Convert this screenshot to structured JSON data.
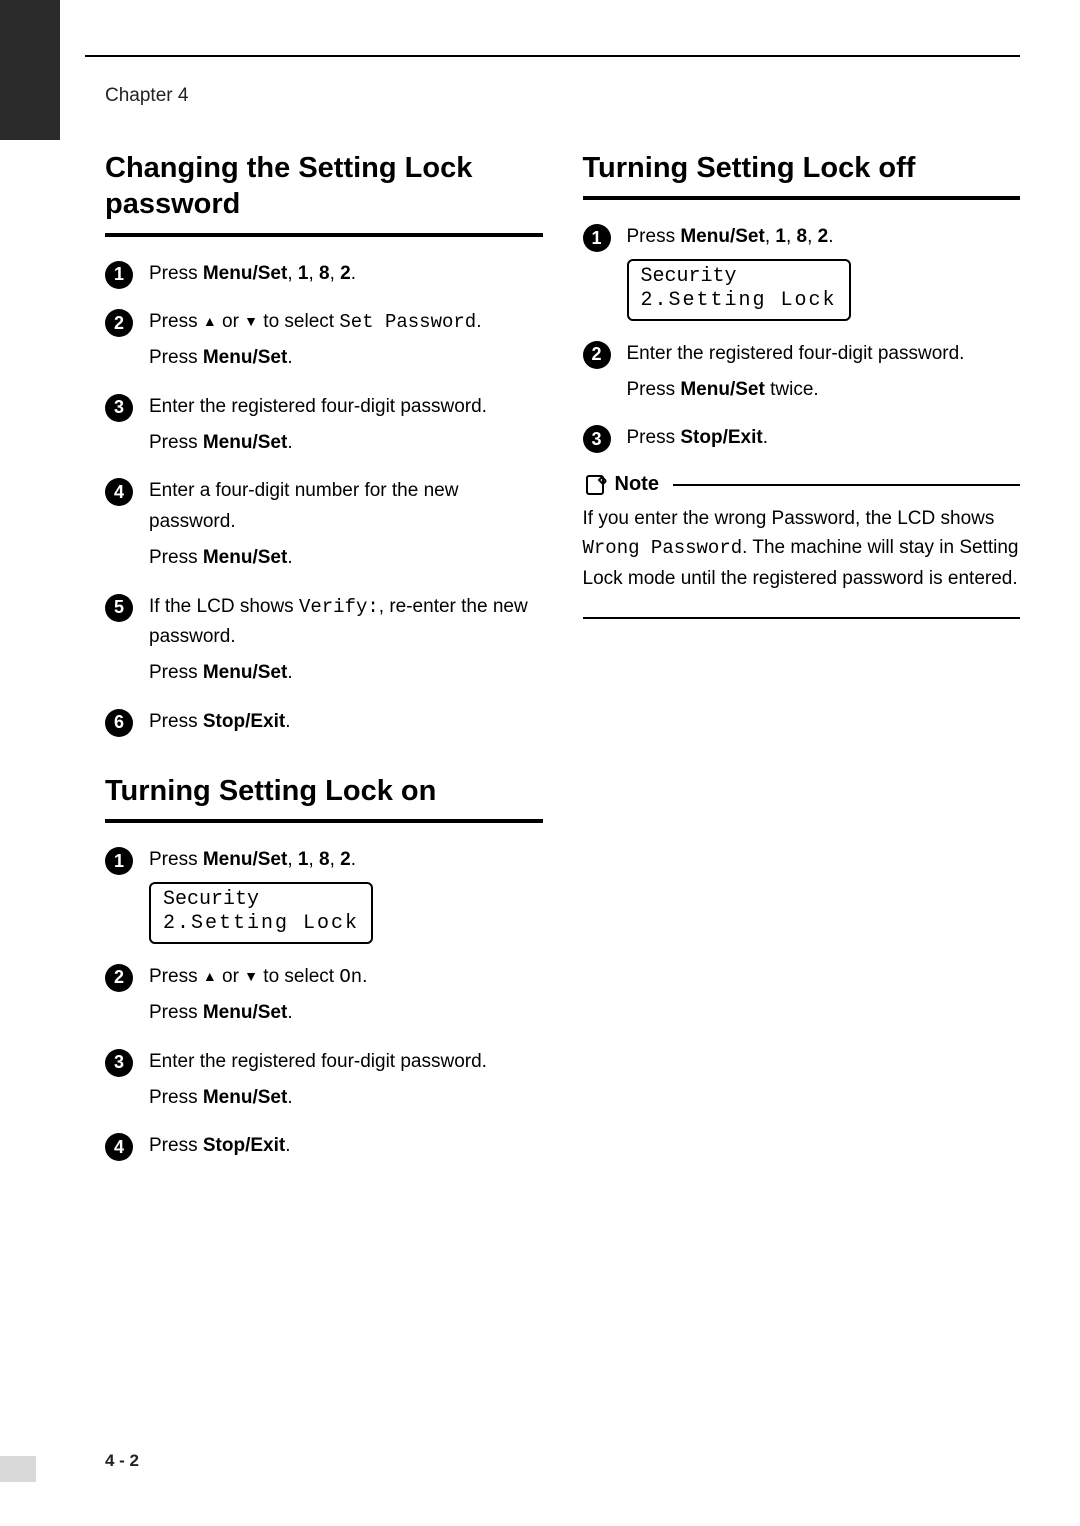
{
  "header": {
    "chapter": "Chapter 4"
  },
  "page_number": "4 - 2",
  "left": {
    "section1": {
      "title": "Changing the Setting Lock password",
      "step1_a": "Press ",
      "step1_b": "Menu/Set",
      "step1_c": ", ",
      "step1_d": "1",
      "step1_e": ", ",
      "step1_f": "8",
      "step1_g": ", ",
      "step1_h": "2",
      "step1_i": ".",
      "step2_a": "Press ",
      "step2_up": "▲",
      "step2_b": " or ",
      "step2_down": "▼",
      "step2_c": " to select ",
      "step2_d": "Set Password",
      "step2_e": ".",
      "step2_f": "Press ",
      "step2_g": "Menu/Set",
      "step2_h": ".",
      "step3_a": "Enter the registered four-digit password.",
      "step3_b": "Press ",
      "step3_c": "Menu/Set",
      "step3_d": ".",
      "step4_a": "Enter a four-digit number for the new password.",
      "step4_b": "Press ",
      "step4_c": "Menu/Set",
      "step4_d": ".",
      "step5_a": "If the LCD shows ",
      "step5_b": "Verify:",
      "step5_c": ", re-enter the new password.",
      "step5_d": "Press ",
      "step5_e": "Menu/Set",
      "step5_f": ".",
      "step6_a": "Press ",
      "step6_b": "Stop/Exit",
      "step6_c": "."
    },
    "section2": {
      "title": "Turning Setting Lock on",
      "step1_a": "Press ",
      "step1_b": "Menu/Set",
      "step1_c": ", ",
      "step1_d": "1",
      "step1_e": ", ",
      "step1_f": "8",
      "step1_g": ", ",
      "step1_h": "2",
      "step1_i": ".",
      "lcd1": "Security",
      "lcd2": "2.Setting Lock",
      "step2_a": "Press ",
      "step2_up": "▲",
      "step2_b": " or ",
      "step2_down": "▼",
      "step2_c": " to select ",
      "step2_d": "On",
      "step2_e": ".",
      "step2_f": "Press ",
      "step2_g": "Menu/Set",
      "step2_h": ".",
      "step3_a": "Enter the registered four-digit password.",
      "step3_b": "Press ",
      "step3_c": "Menu/Set",
      "step3_d": ".",
      "step4_a": "Press ",
      "step4_b": "Stop/Exit",
      "step4_c": "."
    }
  },
  "right": {
    "section1": {
      "title": "Turning Setting Lock off",
      "step1_a": "Press ",
      "step1_b": "Menu/Set",
      "step1_c": ", ",
      "step1_d": "1",
      "step1_e": ", ",
      "step1_f": "8",
      "step1_g": ", ",
      "step1_h": "2",
      "step1_i": ".",
      "lcd1": "Security",
      "lcd2": "2.Setting Lock",
      "step2_a": "Enter the registered four-digit password.",
      "step2_b": "Press ",
      "step2_c": "Menu/Set",
      "step2_d": " twice.",
      "step3_a": "Press ",
      "step3_b": "Stop/Exit",
      "step3_c": ".",
      "note_label": "Note",
      "note_a": "If you enter the wrong Password, the LCD shows ",
      "note_b": "Wrong Password",
      "note_c": ". The machine will stay in Setting Lock mode until the registered password is entered."
    }
  }
}
